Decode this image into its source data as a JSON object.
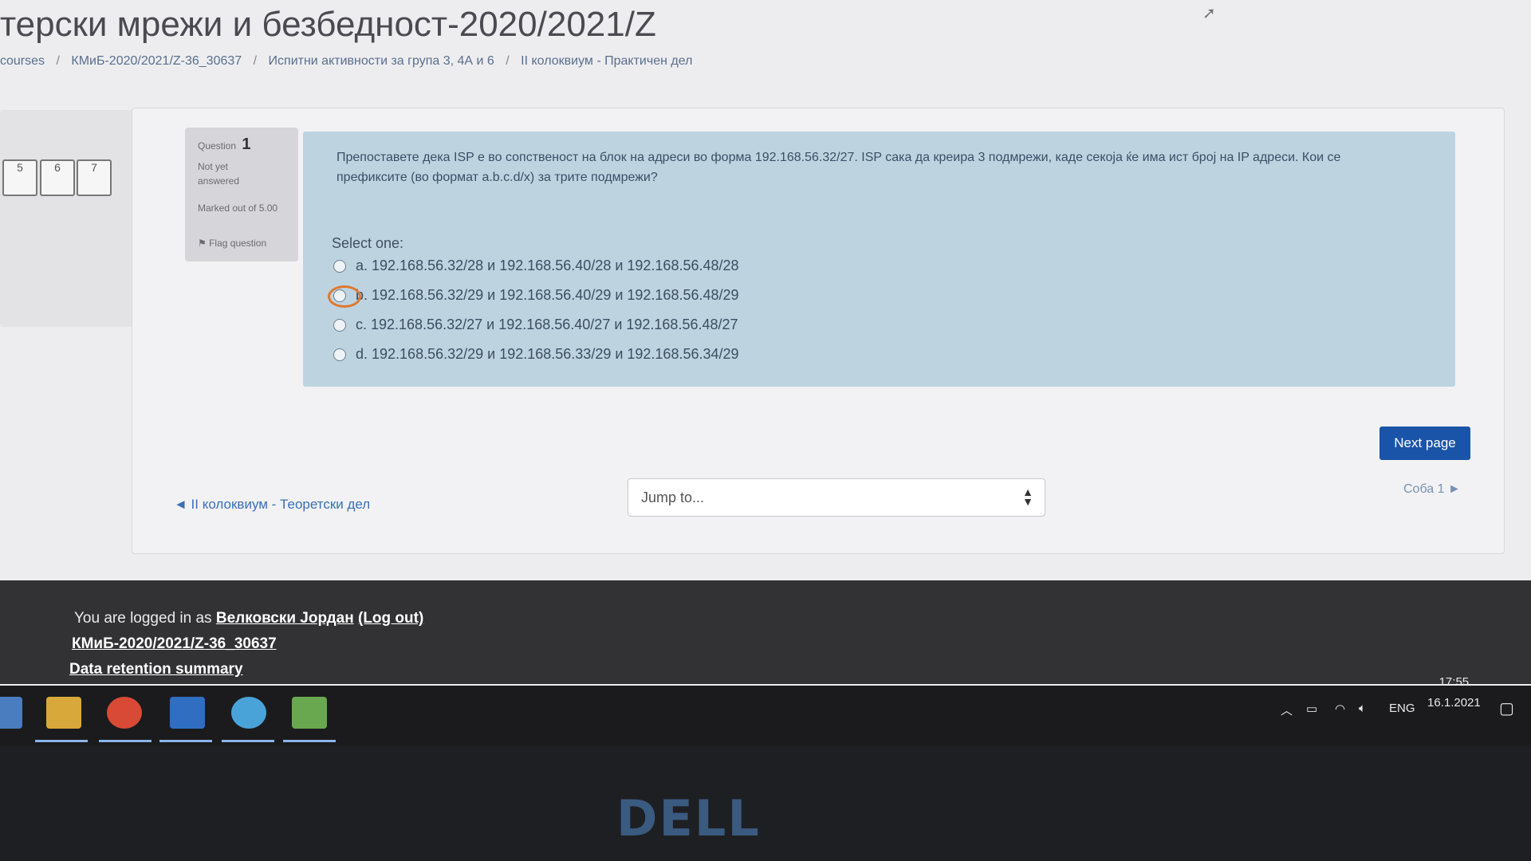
{
  "page": {
    "title": "терски мрежи и безбедност-2020/2021/Z",
    "breadcrumb": [
      "courses",
      "КМиБ-2020/2021/Z-36_30637",
      "Испитни активности за група 3, 4А и 6",
      "II колоквиум - Практичен дел"
    ],
    "breadcrumb_sep": "/"
  },
  "quiz_nav": {
    "buttons": [
      "5",
      "6",
      "7"
    ]
  },
  "question_info": {
    "label": "Question",
    "number": "1",
    "state": "Not yet answered",
    "mark": "Marked out of 5.00",
    "flag": "Flag question"
  },
  "question": {
    "text": "Препоставете дека ISP е во сопственост на блок на адреси во форма 192.168.56.32/27. ISP сака да креира 3 подмрежи, каде секоја ќе има ист број на IP адреси. Кои се префиксите (во формат a.b.c.d/x) за трите подмрежи?",
    "select_one": "Select one:",
    "answers": [
      "a. 192.168.56.32/28 и 192.168.56.40/28 и 192.168.56.48/28",
      "b. 192.168.56.32/29 и 192.168.56.40/29 и 192.168.56.48/29",
      "c. 192.168.56.32/27 и 192.168.56.40/27 и 192.168.56.48/27",
      "d. 192.168.56.32/29 и 192.168.56.33/29 и 192.168.56.34/29"
    ]
  },
  "navigation": {
    "next_page": "Next page",
    "prev_activity": "◄ II колоквиум - Теоретски дел",
    "jump_placeholder": "Jump to...",
    "next_activity": "Соба 1 ►"
  },
  "footer": {
    "logged_in_prefix": "You are logged in as",
    "user_name": "Велковски Јордан",
    "logout": "(Log out)",
    "course_link": "КМиБ-2020/2021/Z-36_30637",
    "data_retention": "Data retention summary"
  },
  "taskbar": {
    "tray_lang": "ENG",
    "time": "17:55",
    "date": "16.1.2021"
  },
  "bezel": {
    "logo": "DELL"
  },
  "colors": {
    "accent": "#1a54a8",
    "highlight": "#e07830",
    "question_bg": "#bdd3e0"
  }
}
